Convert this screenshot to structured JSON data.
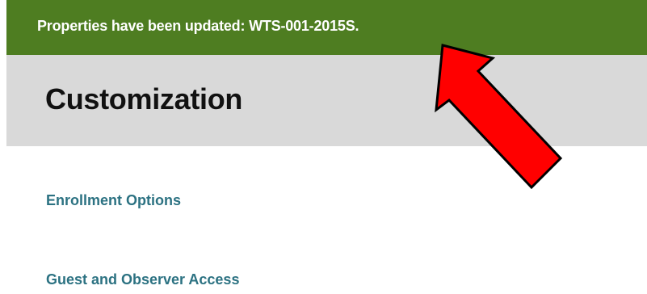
{
  "banner": {
    "message": "Properties have been updated: WTS-001-2015S.",
    "color": "#4e7d21"
  },
  "header": {
    "title": "Customization"
  },
  "links": {
    "enrollment_options": "Enrollment Options",
    "guest_observer_access": "Guest and Observer Access",
    "color": "#2c7282"
  },
  "annotation": {
    "icon": "red-arrow-icon",
    "color": "#ff0000"
  }
}
